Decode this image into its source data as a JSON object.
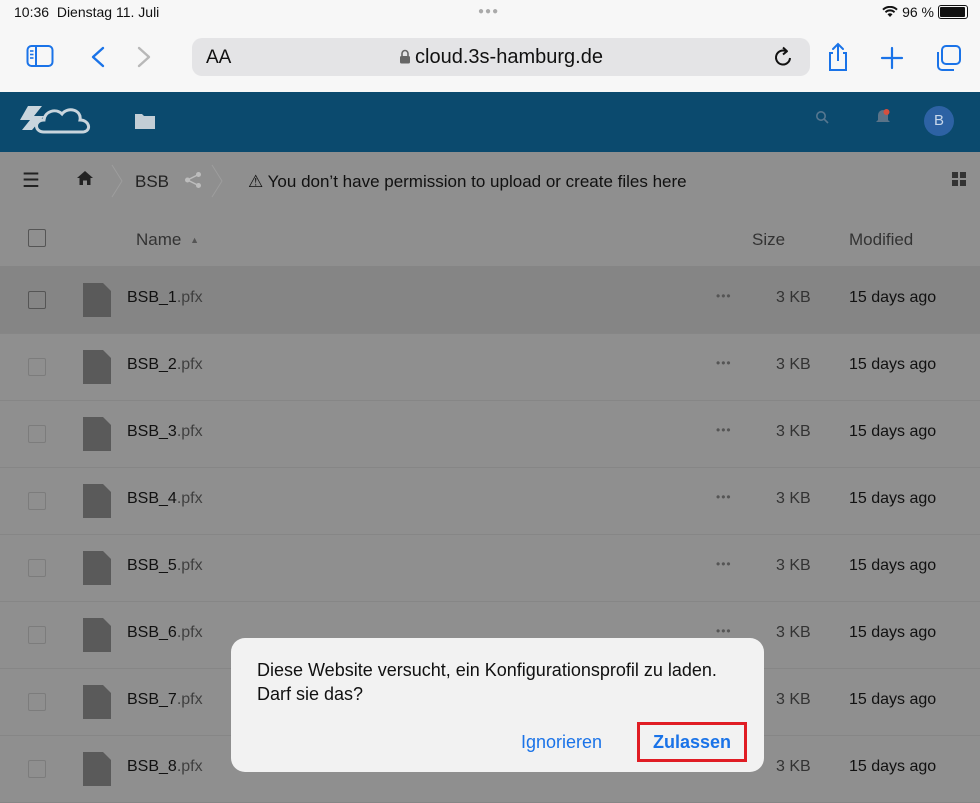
{
  "status": {
    "time": "10:36",
    "date": "Dienstag 11. Juli",
    "battery": "96 %",
    "battery_level": 0.96
  },
  "browser": {
    "text_size": "AA",
    "url": "cloud.3s-hamburg.de"
  },
  "header": {
    "avatar_initial": "B"
  },
  "breadcrumb": {
    "folder": "BSB",
    "warning": "⚠ You don’t have permission to upload or create files here"
  },
  "table": {
    "columns": {
      "name": "Name",
      "sort_indicator": "▲",
      "size": "Size",
      "modified": "Modified"
    },
    "rows": [
      {
        "name": "BSB_1",
        "ext": ".pfx",
        "size": "3 KB",
        "modified": "15 days ago"
      },
      {
        "name": "BSB_2",
        "ext": ".pfx",
        "size": "3 KB",
        "modified": "15 days ago"
      },
      {
        "name": "BSB_3",
        "ext": ".pfx",
        "size": "3 KB",
        "modified": "15 days ago"
      },
      {
        "name": "BSB_4",
        "ext": ".pfx",
        "size": "3 KB",
        "modified": "15 days ago"
      },
      {
        "name": "BSB_5",
        "ext": ".pfx",
        "size": "3 KB",
        "modified": "15 days ago"
      },
      {
        "name": "BSB_6",
        "ext": ".pfx",
        "size": "3 KB",
        "modified": "15 days ago"
      },
      {
        "name": "BSB_7",
        "ext": ".pfx",
        "size": "3 KB",
        "modified": "15 days ago"
      },
      {
        "name": "BSB_8",
        "ext": ".pfx",
        "size": "3 KB",
        "modified": "15 days ago"
      }
    ]
  },
  "dialog": {
    "message": "Diese Website versucht, ein Konfigurationsprofil zu laden. Darf sie das?",
    "ignore_label": "Ignorieren",
    "allow_label": "Zulassen"
  },
  "colors": {
    "accent": "#1a73e8",
    "header_bg": "#0b4a6e",
    "highlight": "#e01d24",
    "avatar_bg": "#2d62a4"
  },
  "icons": [
    "sidebar-icon",
    "back-icon",
    "forward-icon",
    "lock-icon",
    "reload-icon",
    "share-icon",
    "new-tab-icon",
    "tabs-icon",
    "logo",
    "folder-icon",
    "search-icon",
    "bell-icon",
    "menu-icon",
    "home-icon",
    "share-icon",
    "grid-view-icon",
    "file-icon",
    "more-icon",
    "wifi-icon",
    "battery-icon"
  ]
}
